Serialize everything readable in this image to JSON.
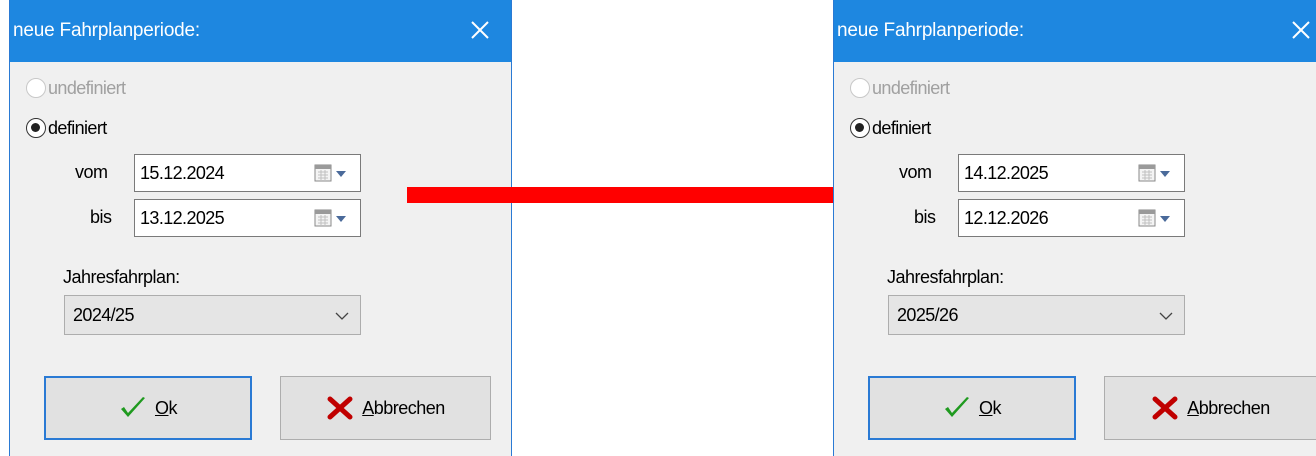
{
  "dialogs": [
    {
      "title": "neue Fahrplanperiode:",
      "radio_undefined": "undefiniert",
      "radio_defined": "definiert",
      "from_label": "vom",
      "from_value": "15.12.2024",
      "to_label": "bis",
      "to_value": "13.12.2025",
      "timetable_label": "Jahresfahrplan:",
      "timetable_value": "2024/25",
      "ok_mnemonic": "O",
      "ok_rest": "k",
      "cancel_mnemonic": "A",
      "cancel_rest": "bbrechen"
    },
    {
      "title": "neue Fahrplanperiode:",
      "radio_undefined": "undefiniert",
      "radio_defined": "definiert",
      "from_label": "vom",
      "from_value": "14.12.2025",
      "to_label": "bis",
      "to_value": "12.12.2026",
      "timetable_label": "Jahresfahrplan:",
      "timetable_value": "2025/26",
      "ok_mnemonic": "O",
      "ok_rest": "k",
      "cancel_mnemonic": "A",
      "cancel_rest": "bbrechen"
    }
  ],
  "colors": {
    "titlebar": "#1e87e0",
    "arrow": "#ff0000",
    "ok_check": "#1f9a1f",
    "cancel_x": "#c00000"
  },
  "icons": {
    "close": "close-icon",
    "calendar": "calendar-dropdown-icon",
    "combo": "chevron-down-icon",
    "ok": "checkmark-icon",
    "cancel": "x-mark-icon",
    "arrow": "arrow-right-icon"
  }
}
